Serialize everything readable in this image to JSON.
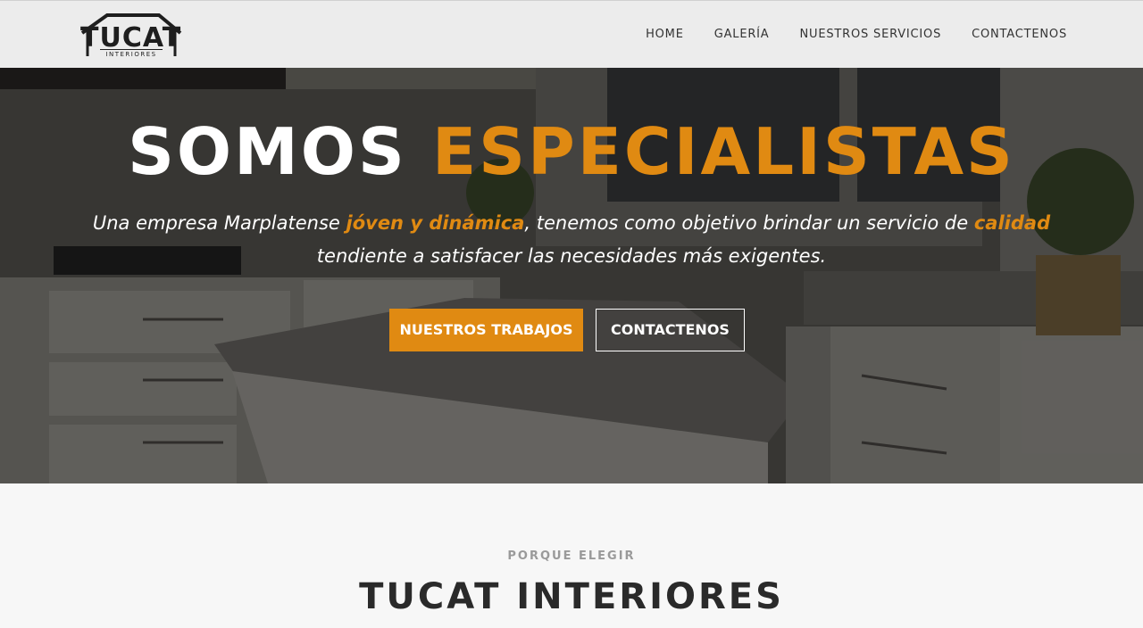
{
  "brand": {
    "logo_word": "TUCAT",
    "logo_sub": "INTERIORES"
  },
  "nav": {
    "items": [
      {
        "label": "HOME"
      },
      {
        "label": "GALERÍA"
      },
      {
        "label": "NUESTROS SERVICIOS"
      },
      {
        "label": "CONTACTENOS"
      }
    ]
  },
  "hero": {
    "title_part1": "SOMOS",
    "title_part2": "ESPECIALISTAS",
    "text_1": "Una empresa Marplatense ",
    "text_hl_1": "jóven y dinámica",
    "text_2": ", tenemos como objetivo brindar un servicio de ",
    "text_hl_2": "calidad",
    "text_3": " tendiente a satisfacer las necesidades más exigentes.",
    "primary_button": "NUESTROS TRABAJOS",
    "secondary_button": "CONTACTENOS"
  },
  "section": {
    "kicker": "PORQUE ELEGIR",
    "title": "TUCAT INTERIORES"
  },
  "colors": {
    "accent": "#e08a12",
    "navbar_bg": "#ececec",
    "section_bg": "#f7f7f7"
  }
}
